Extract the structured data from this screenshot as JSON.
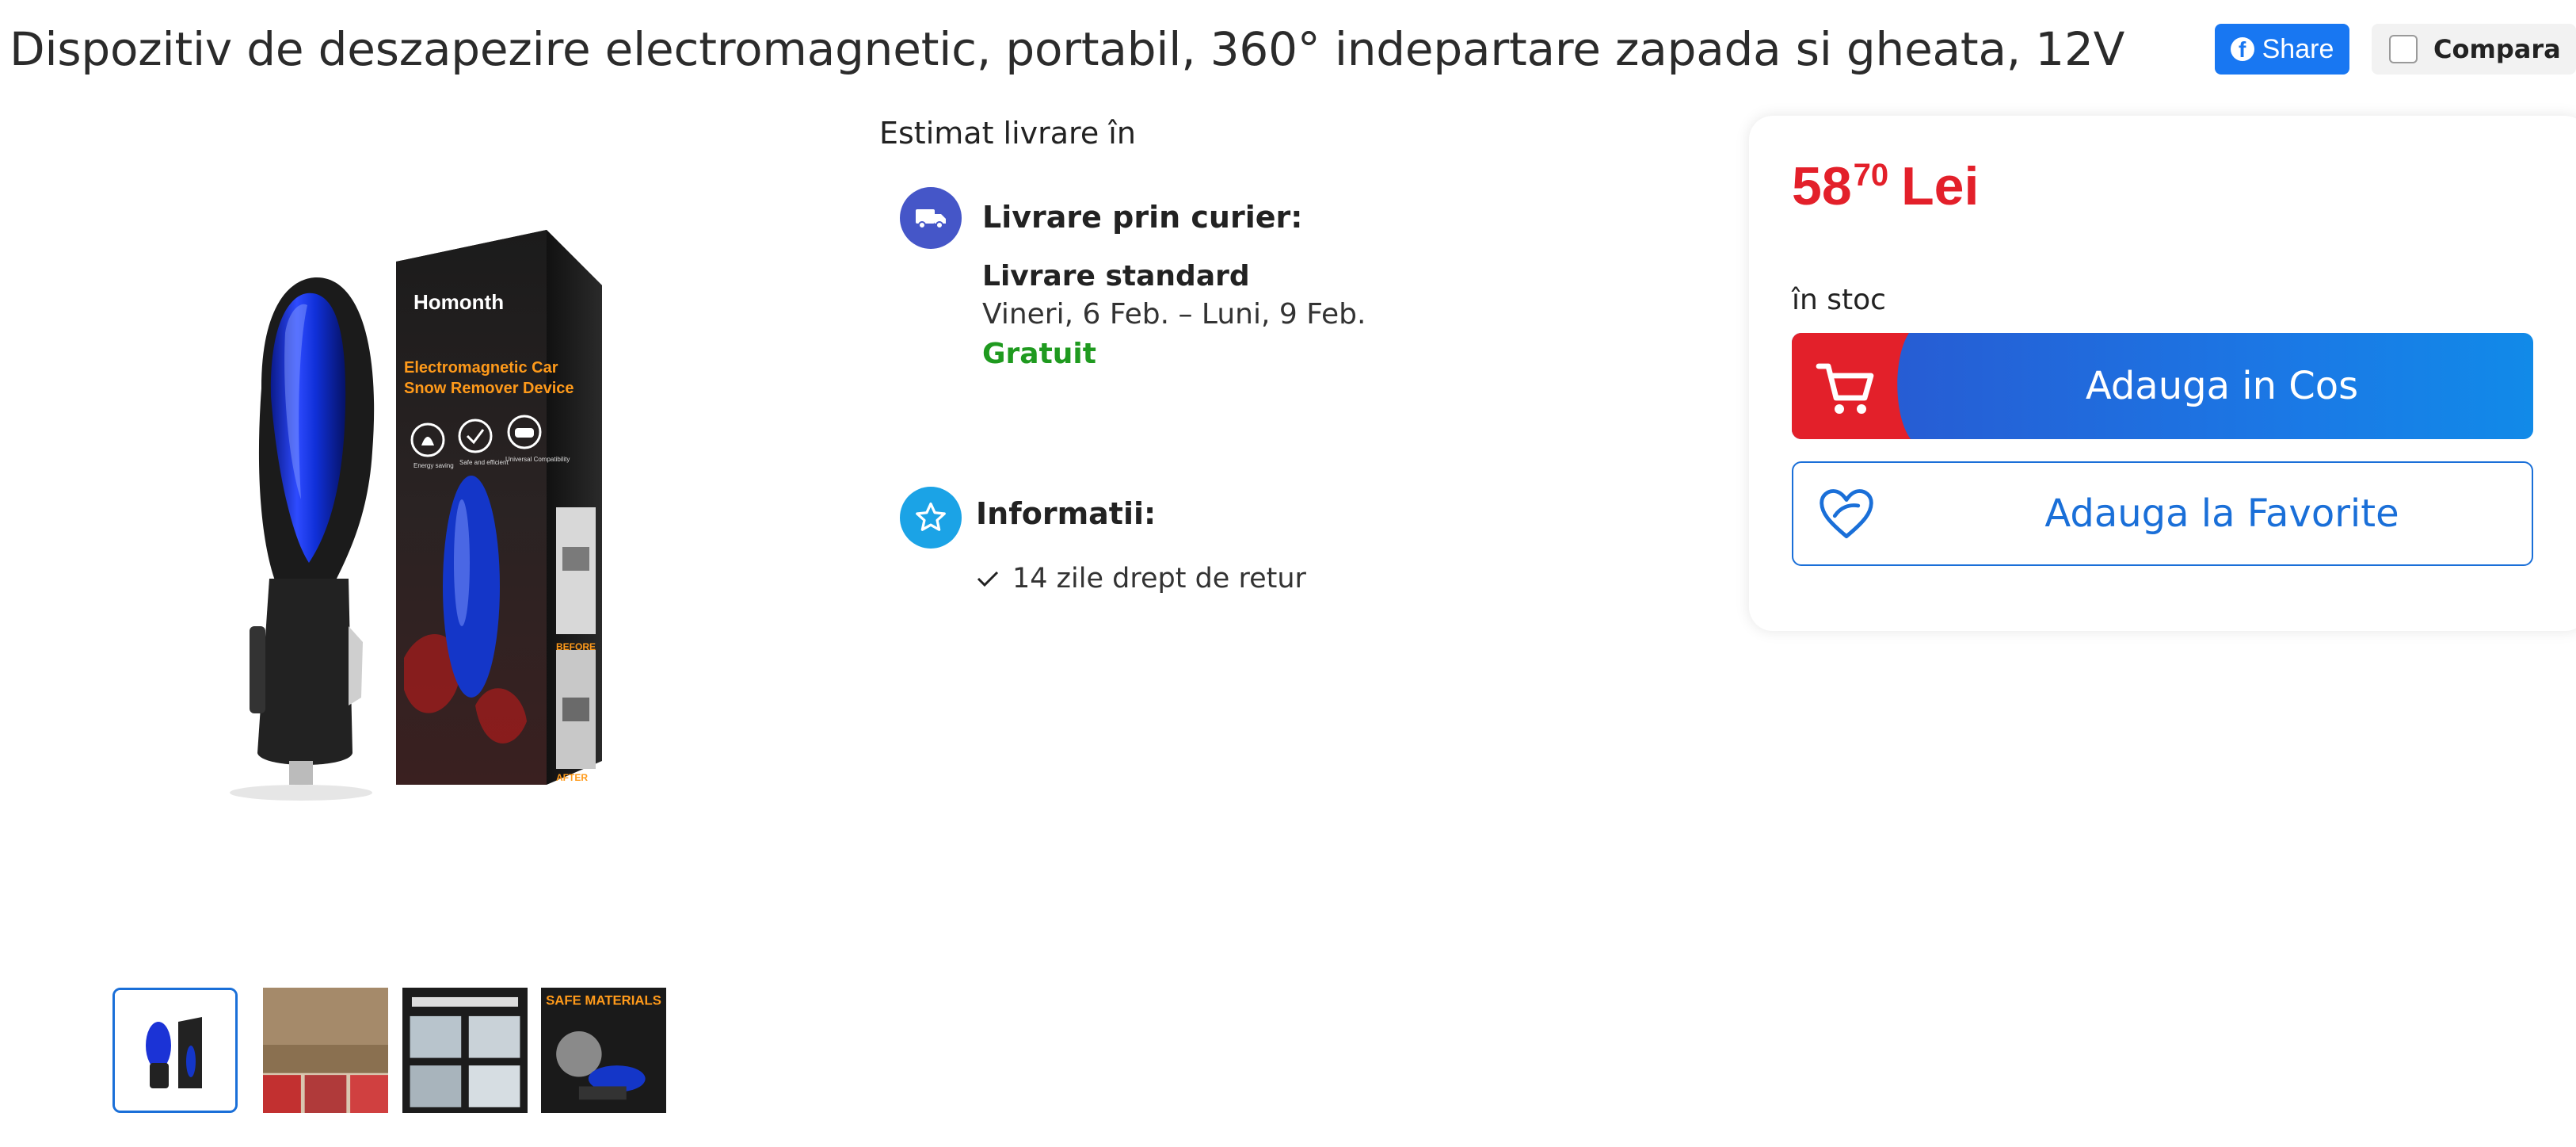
{
  "product": {
    "title": "Dispozitiv de deszapezire electromagnetic, portabil, 360° indepartare zapada si gheata, 12V",
    "image_box_brand": "Homonth",
    "image_box_line1": "Electromagnetic Car",
    "image_box_line2": "Snow Remover Device",
    "image_box_before": "BEFORE",
    "image_box_after": "AFTER",
    "image_box_features": [
      "Energy saving",
      "Safe and efficient",
      "Universal Compatibility"
    ],
    "thumb4_caption": "SAFE MATERIALS"
  },
  "header_actions": {
    "share_label": "Share",
    "compare_label": "Compara"
  },
  "delivery": {
    "heading": "Estimat livrare în",
    "courier_label": "Livrare prin curier:",
    "standard_label": "Livrare standard",
    "standard_dates": "Vineri, 6 Feb. – Luni, 9 Feb.",
    "standard_price": "Gratuit"
  },
  "info": {
    "label": "Informatii:",
    "return_policy": "14 zile drept de retur"
  },
  "buy_box": {
    "price_integer": "58",
    "price_decimals": "70",
    "currency": "Lei",
    "stock": "în stoc",
    "add_to_cart_label": "Adauga in Cos",
    "add_to_favorites_label": "Adauga la Favorite"
  },
  "colors": {
    "price_red": "#e3202a",
    "primary_blue": "#1a6fd8",
    "free_green": "#1f9a1f",
    "facebook_blue": "#1877f2"
  },
  "icons": [
    "facebook-icon",
    "checkbox-icon",
    "truck-icon",
    "star-icon",
    "check-icon",
    "cart-icon",
    "heart-icon"
  ]
}
